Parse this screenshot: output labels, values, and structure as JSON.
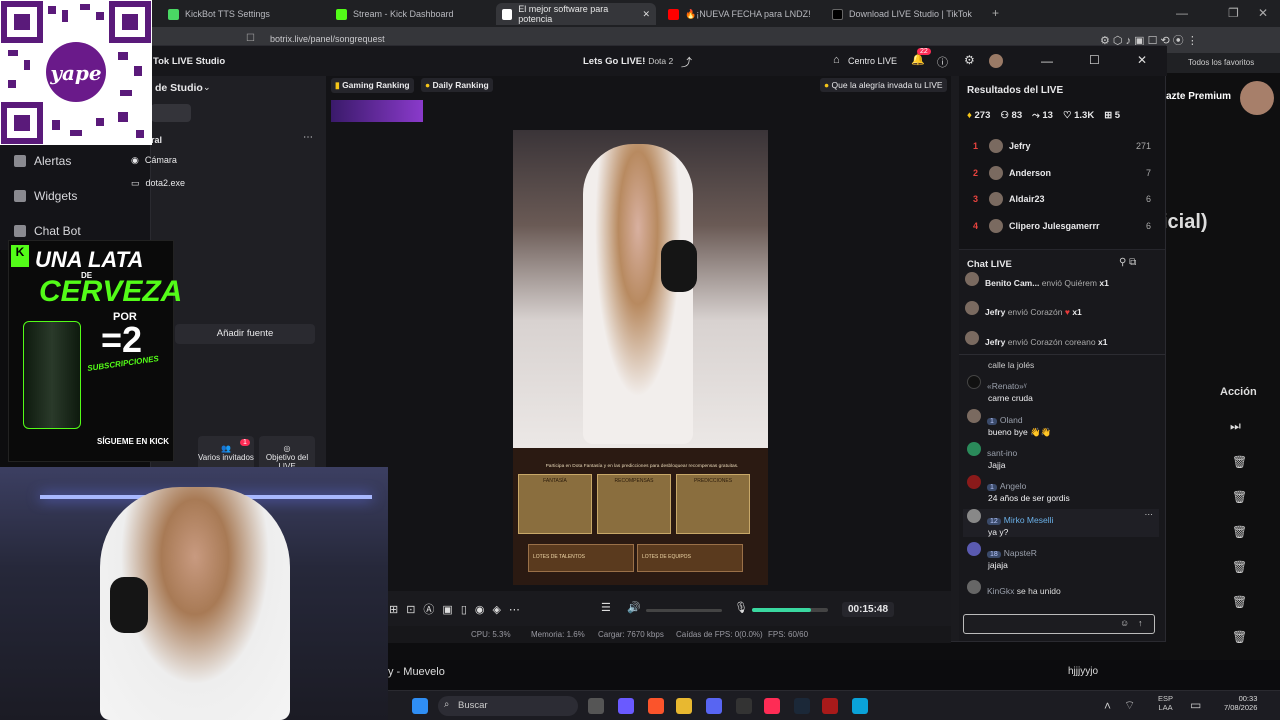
{
  "browser": {
    "tabs": [
      {
        "label": "KickBot TTS Settings",
        "color": "#4ad864"
      },
      {
        "label": "Stream - Kick Dashboard",
        "color": "#53fc18"
      },
      {
        "label": "El mejor software para potencia",
        "color": "#ffffff"
      },
      {
        "label": "🔥¡NUEVA FECHA para LNDZ!",
        "color": "#ff0000"
      },
      {
        "label": "Download LIVE Studio | TikTok",
        "color": "#000000"
      }
    ],
    "url": "botrix.live/panel/songrequest",
    "favorites_label": "Todos los favoritos"
  },
  "leftnav": {
    "items": [
      {
        "label": "Alertas",
        "icon": "bell-icon"
      },
      {
        "label": "Widgets",
        "icon": "grid-icon"
      },
      {
        "label": "Chat Bot",
        "icon": "robot-icon"
      }
    ]
  },
  "studio": {
    "title": "Tok LIVE Studio",
    "scene_label": "de Studio",
    "stream_title": "Lets Go LIVE!",
    "game": "· Dota 2",
    "centro_label": "Centro LIVE",
    "notif_count": "22",
    "sources_header": "ral",
    "sources": [
      {
        "label": "Cámara",
        "icon": "camera-icon"
      },
      {
        "label": "dota2.exe",
        "icon": "window-icon"
      }
    ],
    "add_source": "Añadir fuente",
    "tools_header": "ntas",
    "tools": [
      {
        "label": "Varios invitados",
        "badge": "1"
      },
      {
        "label": "Objetivo del LIVE",
        "badge": ""
      }
    ],
    "tags": [
      {
        "label": "Gaming Ranking"
      },
      {
        "label": "Daily Ranking"
      }
    ],
    "banner_tag": "Que la alegría invada tu LIVE",
    "timer": "00:15:48",
    "stats": {
      "cpu": "CPU:  5.3%",
      "mem": "Memoria:  1.6%",
      "load": "Cargar:  7670 kbps",
      "drops": "Caídas de FPS:  0(0.0%)",
      "fps": "FPS:  60/60"
    },
    "game_text": {
      "intro": "Participa en Dota Fantasía y en las predicciones para desbloquear recompensas gratuitas.",
      "cards": [
        "FANTASÍA",
        "RECOMPENSAS",
        "PREDICCIONES"
      ],
      "bundles": [
        "LOTES DE TALENTOS",
        "LOTES DE EQUIPOS"
      ]
    }
  },
  "results": {
    "title": "Resultados del LIVE",
    "stats": [
      {
        "icon": "diamond-icon",
        "value": "273"
      },
      {
        "icon": "users-icon",
        "value": "83"
      },
      {
        "icon": "share-icon",
        "value": "13"
      },
      {
        "icon": "heart-icon",
        "value": "1.3K"
      },
      {
        "icon": "gift-icon",
        "value": "5"
      }
    ],
    "ranking": [
      {
        "rank": "1",
        "name": "Jefry",
        "score": "271"
      },
      {
        "rank": "2",
        "name": "Anderson",
        "score": "7"
      },
      {
        "rank": "3",
        "name": "Aldair23",
        "score": "6"
      },
      {
        "rank": "4",
        "name": "Clipero Julesgamerrr",
        "score": "6"
      }
    ]
  },
  "chat": {
    "title": "Chat LIVE",
    "gifts": [
      {
        "name": "Benito Cam...",
        "action": "envió Quiérem",
        "count": "x1"
      },
      {
        "name": "Jefry",
        "action": "envió Corazón",
        "count": "x1"
      },
      {
        "name": "Jefry",
        "action": "envió Corazón coreano",
        "count": "x1"
      }
    ],
    "messages": [
      {
        "name": "",
        "badge": "",
        "text": "calle la jolés"
      },
      {
        "name": "«Renato»ᵞ",
        "badge": "",
        "text": "carne cruda"
      },
      {
        "name": "Oland",
        "badge": "1",
        "text": "bueno bye 👋👋"
      },
      {
        "name": "sant-ino",
        "badge": "",
        "text": "Jajja"
      },
      {
        "name": "Angelo",
        "badge": "1",
        "text": "24 años de ser gordis"
      },
      {
        "name": "Mirko Meselli",
        "badge": "12",
        "text": "ya y?"
      },
      {
        "name": "NapsteR",
        "badge": "18",
        "text": "jajaja"
      },
      {
        "name": "KinGkx",
        "badge": "",
        "text": "se ha unido"
      }
    ]
  },
  "bgpage": {
    "premium": "azte Premium",
    "heading": "icial)",
    "action_header": "Acción"
  },
  "songbar": {
    "left": "y - Muevelo",
    "right": "hjjjyyjo"
  },
  "taskbar": {
    "search": "Buscar",
    "lang": "ESP",
    "lang2": "LAA",
    "time": "00:33",
    "date": "7/08/2026"
  },
  "promo": {
    "line1": "UNA LATA",
    "line2": "DE",
    "line3": "CERVEZA",
    "line4": "POR",
    "line5": "=2",
    "line6": "SUBSCRIPCIONES",
    "footer": "SÍGUEME EN KICK"
  },
  "colors": {
    "accent_red": "#e8433e",
    "tiktok_pink": "#fe2c55",
    "kick_green": "#53fc18"
  }
}
